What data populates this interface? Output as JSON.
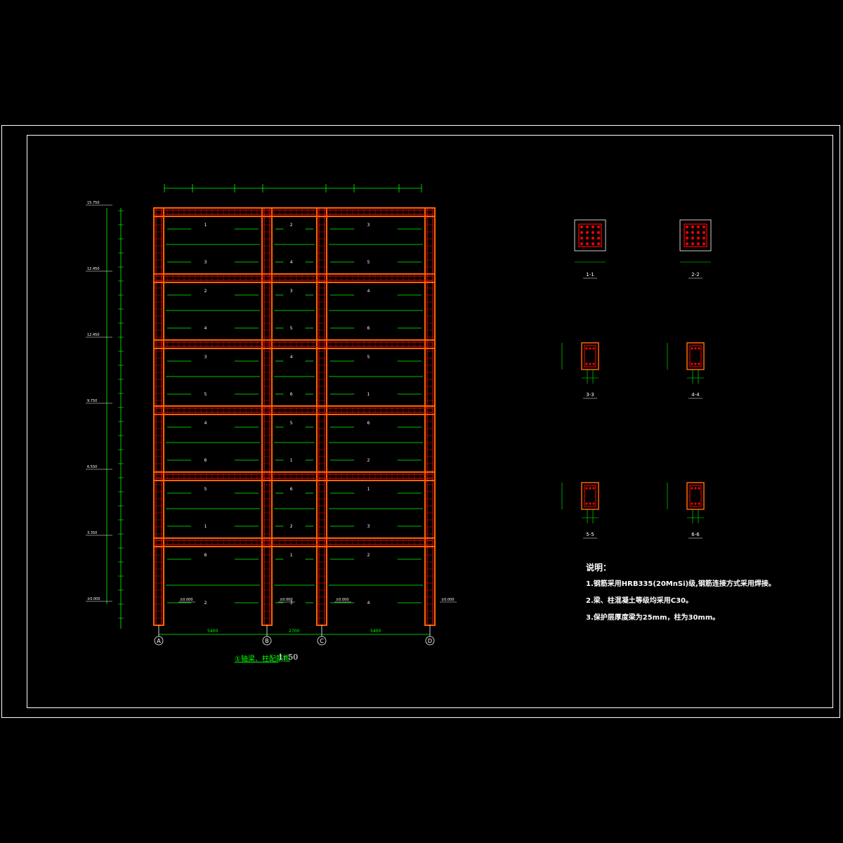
{
  "drawing": {
    "title": "①轴梁、柱配筋图",
    "scale": "1: 50",
    "axes": [
      "A",
      "B",
      "C",
      "D"
    ],
    "spans": [
      "5400",
      "2700",
      "5400"
    ],
    "elevations": [
      "15.750",
      "12.450",
      "12.450",
      "9.750",
      "6.550",
      "3.350",
      "±0.000"
    ],
    "ground_levels": [
      "±0.000",
      "±0.000",
      "±0.000",
      "±0.000"
    ],
    "beam_marks": [
      "1",
      "2",
      "3",
      "4",
      "5",
      "6"
    ],
    "sections": [
      "1-1",
      "2-2",
      "3-3",
      "4-4",
      "5-5",
      "6-6"
    ]
  },
  "notes": {
    "title": "说明：",
    "items": [
      "1.钢筋采用HRB335(20MnSi)级,钢筋连接方式采用焊接。",
      "2.梁、柱混凝土等级均采用C30。",
      "3.保护层厚度梁为25mm，柱为30mm。"
    ]
  },
  "colors": {
    "background": "#000000",
    "frame": "#ffffff",
    "concrete": "#ff6600",
    "rebar": "#ff0000",
    "dimension": "#00ff00",
    "text": "#ffffff"
  }
}
